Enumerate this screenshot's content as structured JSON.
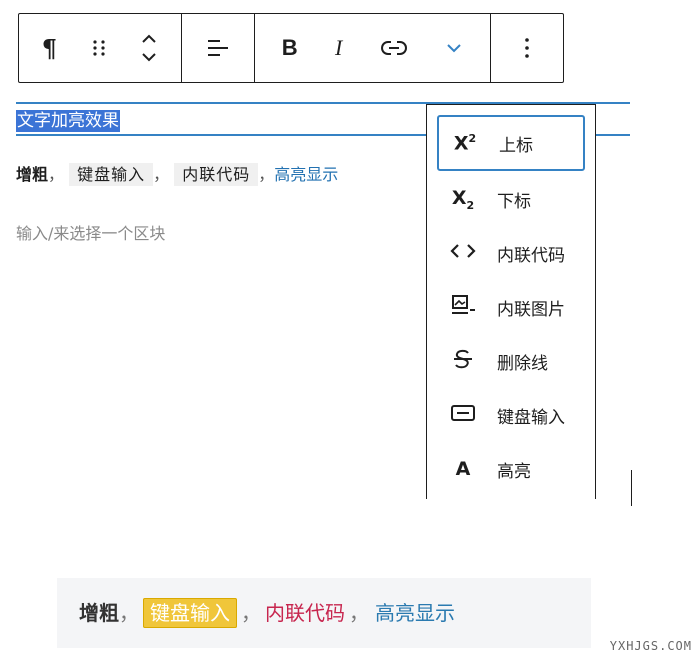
{
  "toolbar": {
    "paragraph_icon_glyph": "¶",
    "bold_label": "B",
    "italic_label": "I"
  },
  "heading": {
    "text": "文字加亮效果"
  },
  "paragraph": {
    "bold": "增粗",
    "sep1": "，",
    "keyboard": "键盘输入",
    "sep2": "，",
    "code": "内联代码",
    "sep3": "，",
    "highlight": "高亮显示"
  },
  "placeholder": "输入/来选择一个区块",
  "menu": {
    "items": [
      {
        "icon": "superscript-icon",
        "glyph": "X²",
        "label": "上标",
        "active": true
      },
      {
        "icon": "subscript-icon",
        "glyph": "X₂",
        "label": "下标"
      },
      {
        "icon": "inline-code-icon",
        "glyph": "‹›",
        "label": "内联代码"
      },
      {
        "icon": "inline-image-icon",
        "glyph": "",
        "label": "内联图片"
      },
      {
        "icon": "strikethrough-icon",
        "glyph": "S",
        "label": "删除线"
      },
      {
        "icon": "keyboard-input-icon",
        "glyph": "",
        "label": "键盘输入"
      },
      {
        "icon": "highlight-icon",
        "glyph": "A",
        "label": "高亮"
      }
    ]
  },
  "preview": {
    "bold": "增粗",
    "sep1": "，",
    "keyboard": "键盘输入",
    "sep2": "，",
    "code": "内联代码",
    "sep3": "，",
    "highlight": "高亮显示"
  },
  "watermark": "YXHJGS.COM",
  "colors": {
    "accent": "#3582c4",
    "selection": "#3b74d6",
    "highlight_text": "#2271b1",
    "kbd_bg": "#f0c63a",
    "code_text": "#c7254e"
  }
}
